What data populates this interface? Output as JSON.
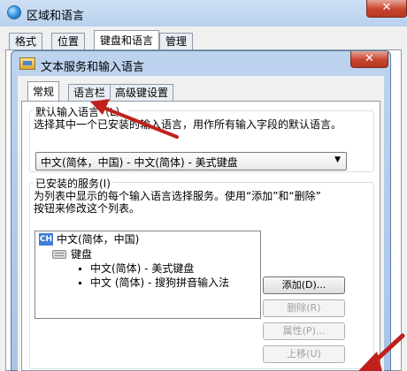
{
  "outer_window": {
    "title": "区域和语言",
    "close_glyph": "✕",
    "tabs": [
      {
        "label": "格式"
      },
      {
        "label": "位置"
      },
      {
        "label": "键盘和语言"
      },
      {
        "label": "管理"
      }
    ],
    "active_tab": "键盘和语言"
  },
  "dialog": {
    "title": "文本服务和输入语言",
    "close_glyph": "✕",
    "tabs": [
      {
        "label": "常规"
      },
      {
        "label": "语言栏"
      },
      {
        "label": "高级键设置"
      }
    ],
    "active_tab": "常规",
    "default_language": {
      "label": "默认输入语言（L）",
      "description": "选择其中一个已安装的输入语言，用作所有输入字段的默认语言。",
      "selected": "中文(简体，中国) - 中文(简体) - 美式键盘",
      "arrow": "▼"
    },
    "installed_services": {
      "label": "已安装的服务(I)",
      "description_line1": "为列表中显示的每个输入语言选择服务。使用“添加”和“删除”",
      "description_line2": "按钮来修改这个列表。",
      "tree": {
        "language_badge": "CH",
        "language": "中文(简体，中国)",
        "category": "键盘",
        "items": [
          "中文(简体) - 美式键盘",
          "中文 (简体) - 搜狗拼音输入法"
        ]
      },
      "buttons": {
        "add": "添加(D)...",
        "remove": "删除(R)",
        "properties": "属性(P)...",
        "move_up": "上移(U)"
      }
    }
  },
  "colors": {
    "annotation_arrow": "#c0201b",
    "close_button": "#c9432c",
    "titlebar": "#b8d1ee"
  }
}
